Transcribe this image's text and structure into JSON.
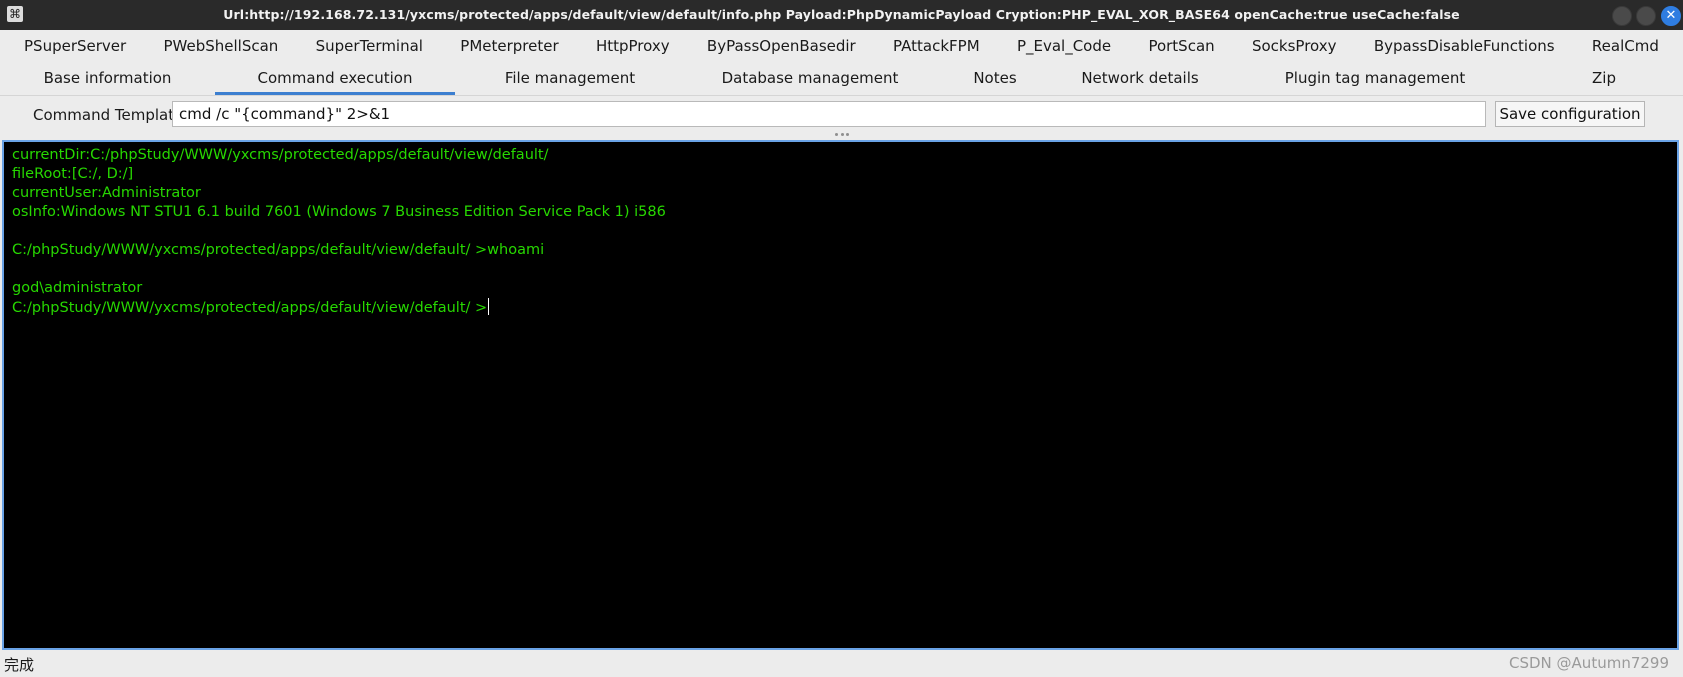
{
  "window": {
    "title": "Url:http://192.168.72.131/yxcms/protected/apps/default/view/default/info.php Payload:PhpDynamicPayload Cryption:PHP_EVAL_XOR_BASE64 openCache:true useCache:false",
    "app_icon": "shell-icon",
    "close_glyph": "✕"
  },
  "plugin_tabs": [
    "PSuperServer",
    "PWebShellScan",
    "SuperTerminal",
    "PMeterpreter",
    "HttpProxy",
    "ByPassOpenBasedir",
    "PAttackFPM",
    "P_Eval_Code",
    "PortScan",
    "SocksProxy",
    "BypassDisableFunctions",
    "RealCmd"
  ],
  "main_tabs": [
    {
      "label": "Base information"
    },
    {
      "label": "Command execution",
      "active": true
    },
    {
      "label": "File management"
    },
    {
      "label": "Database management"
    },
    {
      "label": "Notes"
    },
    {
      "label": "Network details"
    },
    {
      "label": "Plugin tag management"
    },
    {
      "label": "Zip"
    }
  ],
  "command_template": {
    "label": "Command Template",
    "value": "cmd /c \"{command}\" 2>&1",
    "save_label": "Save configuration"
  },
  "terminal": {
    "lines": [
      "currentDir:C:/phpStudy/WWW/yxcms/protected/apps/default/view/default/",
      "fileRoot:[C:/, D:/]",
      "currentUser:Administrator",
      "osInfo:Windows NT STU1 6.1 build 7601 (Windows 7 Business Edition Service Pack 1) i586",
      "",
      "C:/phpStudy/WWW/yxcms/protected/apps/default/view/default/ >whoami",
      "",
      "god\\administrator",
      "C:/phpStudy/WWW/yxcms/protected/apps/default/view/default/ >"
    ],
    "text_color": "#27d800",
    "background": "#000000"
  },
  "status": {
    "text": "完成",
    "watermark": "CSDN @Autumn7299"
  }
}
